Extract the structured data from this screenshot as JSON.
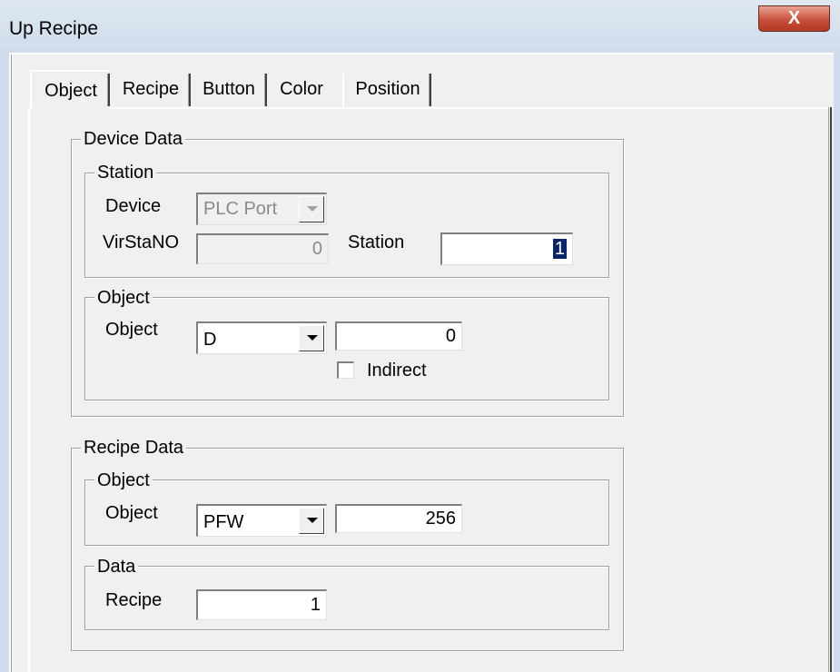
{
  "window": {
    "title": "Up Recipe",
    "close_label": "X"
  },
  "tabs": [
    {
      "label": "Object",
      "active": true
    },
    {
      "label": "Recipe",
      "active": false
    },
    {
      "label": "Button",
      "active": false
    },
    {
      "label": "Color",
      "active": false
    },
    {
      "label": "Position",
      "active": false
    }
  ],
  "device_data": {
    "title": "Device Data",
    "station": {
      "title": "Station",
      "device_label": "Device",
      "device_value": "PLC Port",
      "virstano_label": "VirStaNO",
      "virstano_value": "0",
      "station_label": "Station",
      "station_value": "1"
    },
    "object": {
      "title": "Object",
      "object_label": "Object",
      "object_type": "D",
      "object_value": "0",
      "indirect_label": "Indirect",
      "indirect_checked": false
    }
  },
  "recipe_data": {
    "title": "Recipe Data",
    "object": {
      "title": "Object",
      "object_label": "Object",
      "object_type": "PFW",
      "object_value": "256"
    },
    "data": {
      "title": "Data",
      "recipe_label": "Recipe",
      "recipe_value": "1"
    }
  }
}
